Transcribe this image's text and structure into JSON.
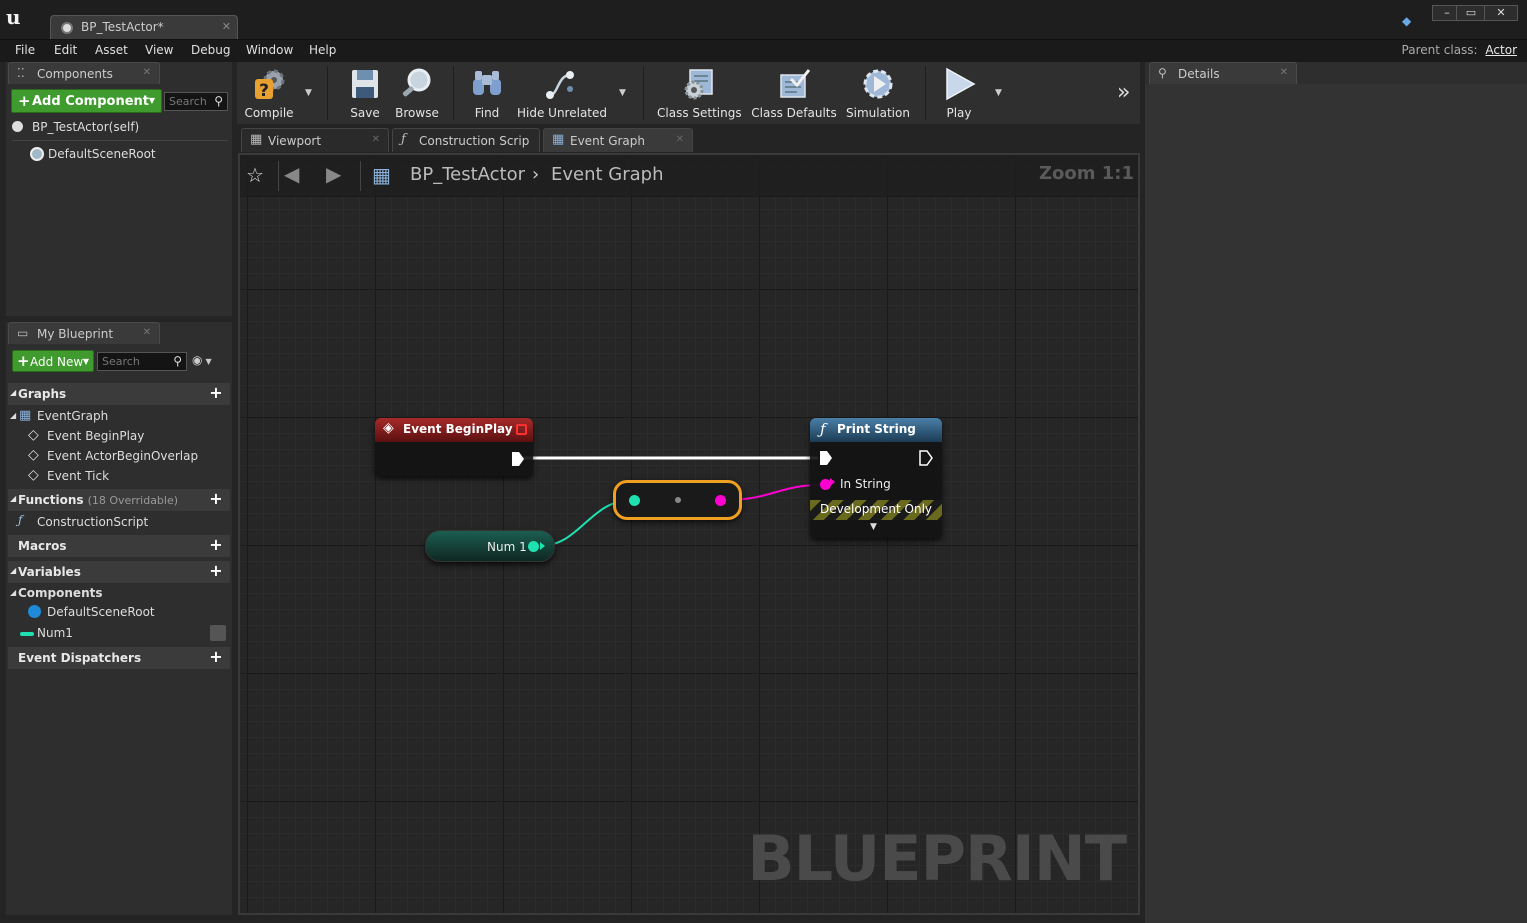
{
  "window": {
    "doc_tab": "BP_TestActor*",
    "controls": [
      "–",
      "▭",
      "✕"
    ]
  },
  "menu": {
    "items": [
      "File",
      "Edit",
      "Asset",
      "View",
      "Debug",
      "Window",
      "Help"
    ],
    "parent_class_label": "Parent class:",
    "parent_class_value": "Actor"
  },
  "components_panel": {
    "title": "Components",
    "add_button": "Add Component",
    "search_placeholder": "Search",
    "tree": [
      "BP_TestActor(self)",
      "DefaultSceneRoot"
    ]
  },
  "my_blueprint": {
    "title": "My Blueprint",
    "add_button": "Add New",
    "search_placeholder": "Search",
    "graphs_label": "Graphs",
    "event_graph": "EventGraph",
    "events": [
      "Event BeginPlay",
      "Event ActorBeginOverlap",
      "Event Tick"
    ],
    "functions_label": "Functions",
    "functions_sub": "(18 Overridable)",
    "construction_script": "ConstructionScript",
    "macros_label": "Macros",
    "variables_label": "Variables",
    "components_label": "Components",
    "default_scene_root": "DefaultSceneRoot",
    "num1": "Num1",
    "dispatchers_label": "Event Dispatchers"
  },
  "toolbar": {
    "compile": "Compile",
    "save": "Save",
    "browse": "Browse",
    "find": "Find",
    "hide_unrelated": "Hide Unrelated",
    "class_settings": "Class Settings",
    "class_defaults": "Class Defaults",
    "simulation": "Simulation",
    "play": "Play"
  },
  "graph_tabs": [
    "Viewport",
    "Construction Scrip",
    "Event Graph"
  ],
  "graph": {
    "breadcrumb_root": "BP_TestActor",
    "breadcrumb_leaf": "Event Graph",
    "zoom": "Zoom 1:1",
    "watermark": "BLUEPRINT",
    "nodes": {
      "begin_play": "Event BeginPlay",
      "print_string": "Print String",
      "in_string": "In String",
      "dev_only": "Development Only",
      "num1": "Num 1"
    }
  },
  "details": {
    "title": "Details"
  },
  "colors": {
    "event_header": "#7a1a1a",
    "function_header": "#2f5a7a",
    "integer_pin": "#1fe0b0",
    "string_pin": "#ff00d0",
    "compile_warn": "#e8a030",
    "add_green": "#3f9b2d"
  }
}
